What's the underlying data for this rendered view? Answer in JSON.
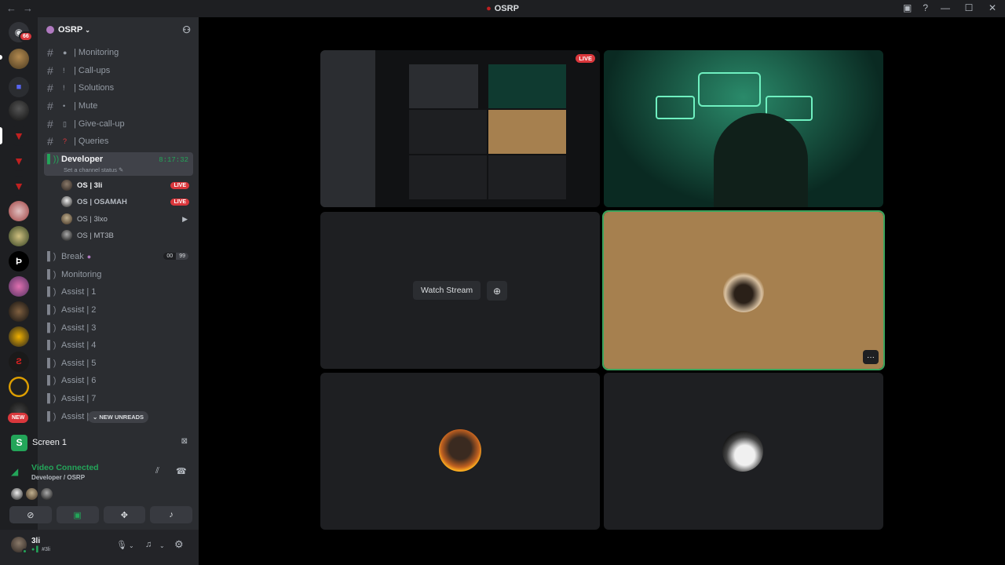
{
  "window": {
    "title": "OSRP",
    "nav_back": "←",
    "nav_fwd": "→",
    "help": "?",
    "min": "—",
    "max": "☐",
    "close": "✕"
  },
  "servers": {
    "home_badge": "66",
    "new_label": "NEW"
  },
  "guild": {
    "name": "OSRP",
    "chevron": "⌄"
  },
  "channels": {
    "text": [
      {
        "emoji": "●",
        "name": "| Monitoring"
      },
      {
        "emoji": "!",
        "name": "| Call-ups"
      },
      {
        "emoji": "!",
        "name": "| Solutions"
      },
      {
        "emoji": "•",
        "name": "| Mute"
      },
      {
        "emoji": "▯",
        "name": "| Give-call-up"
      },
      {
        "emoji": "?",
        "name": "| Queries"
      }
    ],
    "active": {
      "name": "Developer",
      "timer": "8:17:32",
      "status": "Set a channel status ✎"
    },
    "voice_users": [
      {
        "name": "OS | 3li",
        "live": "LIVE"
      },
      {
        "name": "OS | OSAMAH",
        "live": "LIVE"
      },
      {
        "name": "OS | 3lxo",
        "cam": "▶"
      },
      {
        "name": "OS | MT3B"
      }
    ],
    "break": {
      "name": "Break",
      "c1": "00",
      "c2": "99"
    },
    "voice": [
      "Monitoring",
      "Assist | 1",
      "Assist | 2",
      "Assist | 3",
      "Assist | 4",
      "Assist | 5",
      "Assist | 6",
      "Assist | 7",
      "Assist |"
    ],
    "new_unreads": "⌄ NEW UNREADS"
  },
  "panel": {
    "screen_label": "Screen 1",
    "screen_icon": "S",
    "connected": "Video Connected",
    "location": "Developer / OSRP"
  },
  "user": {
    "name": "3li",
    "tag": "#3li"
  },
  "stage": {
    "watch_stream": "Watch Stream",
    "live": "LIVE",
    "more": "···"
  },
  "colors": {
    "accent_green": "#23a559",
    "live_red": "#da373c",
    "sand_tile": "#a6804f"
  }
}
